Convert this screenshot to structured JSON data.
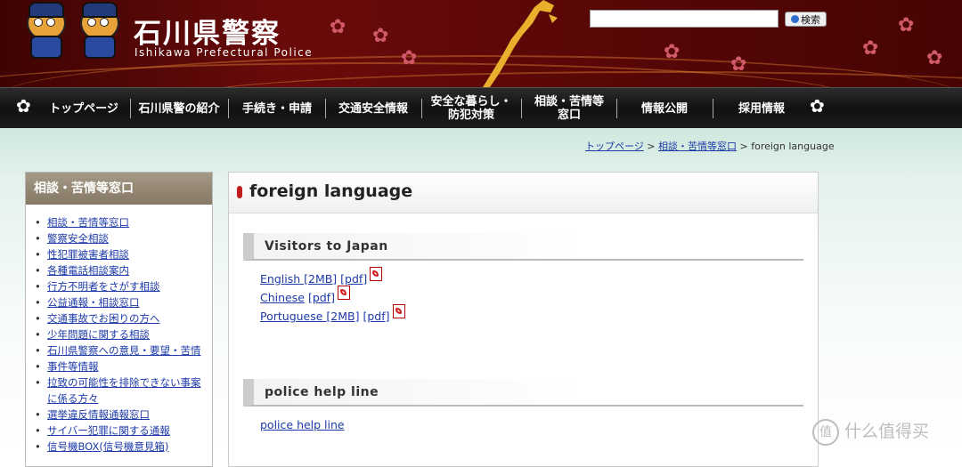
{
  "header": {
    "title": "石川県警察",
    "subtitle": "Ishikawa Prefectural Police",
    "search": {
      "placeholder": "",
      "button_label": "検索"
    }
  },
  "nav": {
    "items": [
      {
        "label": "トップページ"
      },
      {
        "label": "石川県警の紹介"
      },
      {
        "label": "手続き・申請"
      },
      {
        "label": "交通安全情報"
      },
      {
        "label_line1": "安全な暮らし・",
        "label_line2": "防犯対策"
      },
      {
        "label_line1": "相談・苦情等",
        "label_line2": "窓口"
      },
      {
        "label": "情報公開"
      },
      {
        "label": "採用情報"
      }
    ]
  },
  "breadcrumb": {
    "items": [
      "トップページ",
      "相談・苦情等窓口"
    ],
    "separator": ">",
    "current": "foreign language"
  },
  "sidebar": {
    "title": "相談・苦情等窓口",
    "items": [
      "相談・苦情等窓口",
      "警察安全相談",
      "性犯罪被害者相談",
      "各種電話相談案内",
      "行方不明者をさがす相談",
      "公益通報・相談窓口",
      "交通事故でお困りの方へ",
      "少年問題に関する相談",
      "石川県警察への意見・要望・苦情",
      "事件等情報",
      "拉致の可能性を排除できない事案",
      "に係る方々",
      "選挙違反情報通報窓口",
      "サイバー犯罪に関する通報",
      "信号機BOX(信号機意見箱)"
    ]
  },
  "main": {
    "page_title": "foreign language",
    "sections": [
      {
        "heading": "Visitors to Japan",
        "links": [
          {
            "label": "English [2MB]",
            "pdf_label": "[pdf]"
          },
          {
            "label": "Chinese",
            "pdf_label": "[pdf]"
          },
          {
            "label": "Portuguese [2MB]",
            "pdf_label": "[pdf]"
          }
        ]
      },
      {
        "heading": "police help line",
        "links": [
          {
            "label": "police help line"
          }
        ]
      }
    ]
  },
  "watermark": {
    "logo": "值",
    "text": "什么值得买"
  },
  "colors": {
    "header_bg": "#5a0707",
    "nav_bg": "#1a1a1a",
    "sidebar_header": "#938774",
    "link": "#1d3aa8",
    "title_marker": "#c21d1d"
  }
}
